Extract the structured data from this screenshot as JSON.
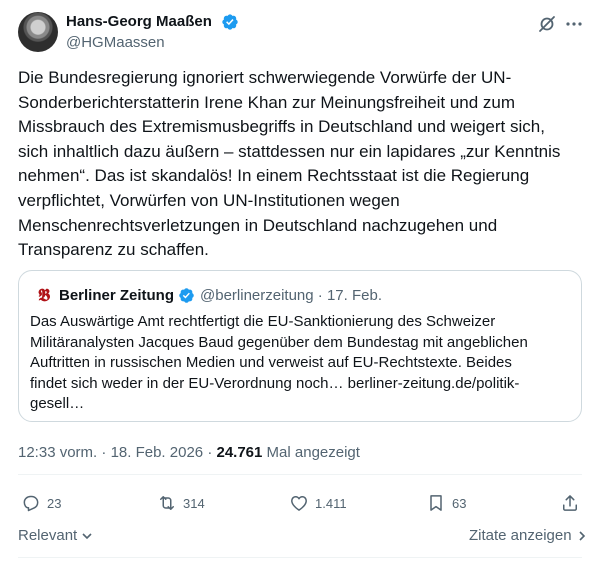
{
  "author": {
    "name": "Hans-Georg Maaßen",
    "handle": "@HGMaassen"
  },
  "tweet": {
    "text": "Die Bundesregierung ignoriert schwerwiegende Vorwürfe der UN-\nSonderberichterstatterin Irene Khan zur Meinungsfreiheit und zum\nMissbrauch des Extremismusbegriffs in Deutschland und weigert sich,\nsich inhaltlich dazu äußern – stattdessen nur ein lapidares „zur Kenntnis\nnehmen“. Das ist skandalös! In einem Rechtsstaat ist die Regierung\nverpflichtet, Vorwürfen von UN-Institutionen wegen\nMenschenrechtsverletzungen in Deutschland nachzugehen und\nTransparenz zu schaffen."
  },
  "quote": {
    "name": "Berliner Zeitung",
    "handle": "@berlinerzeitung",
    "separator": "·",
    "date": "17. Feb.",
    "text": "Das Auswärtige Amt rechtfertigt die EU-Sanktionierung des Schweizer\nMilitäranalysten Jacques Baud gegenüber dem Bundestag mit angeblichen\nAuftritten in russischen Medien und verweist auf EU-Rechtstexte. Beides\nfindet sich weder in der EU-Verordnung noch… berliner-zeitung.de/politik-\ngesell…"
  },
  "meta": {
    "time": "12:33 vorm.",
    "sep1": "·",
    "date": "18. Feb. 2026",
    "sep2": "·",
    "views": "24.761",
    "views_label": "Mal angezeigt"
  },
  "actions": {
    "replies": "23",
    "reposts": "314",
    "likes": "1.411",
    "bookmarks": "63"
  },
  "footer": {
    "sort_label": "Relevant",
    "quotes_label": "Zitate anzeigen"
  },
  "colors": {
    "verified": "#1d9bf0",
    "secondary_text": "#536471",
    "border": "#cfd9de",
    "berliner_logo": "#b01217"
  }
}
